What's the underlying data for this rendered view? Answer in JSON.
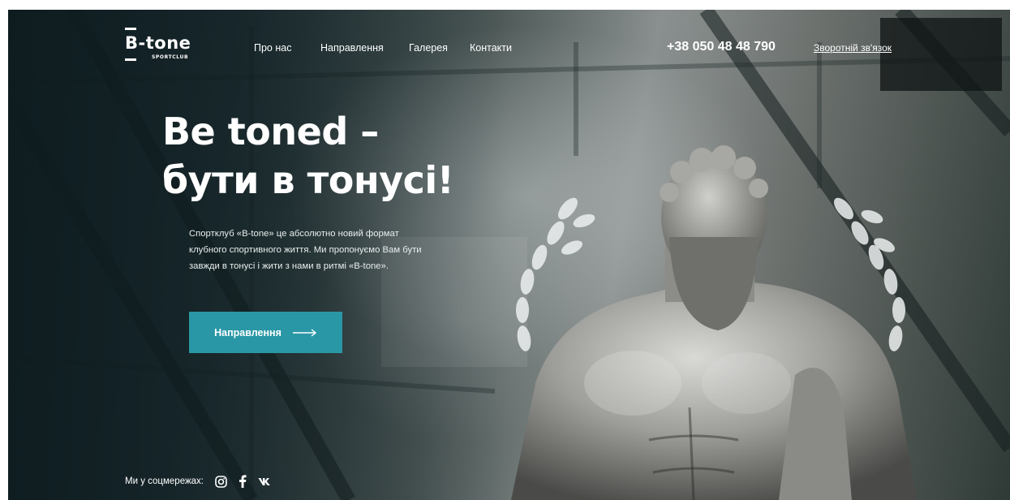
{
  "brand": {
    "name": "B-tone",
    "tagline": "SPORTCLUB"
  },
  "nav": {
    "items": [
      {
        "label": "Про нас"
      },
      {
        "label": "Направлення"
      },
      {
        "label": "Галерея"
      },
      {
        "label": "Контакти"
      }
    ]
  },
  "contact": {
    "phone": "+38 050 48 48 790",
    "callback_label": "Зворотній зв'язок"
  },
  "hero": {
    "headline_line1": "Be toned –",
    "headline_line2": "бути в тонусі!",
    "description": "Спортклуб «B-tone» це абсолютно новий формат клубного спортивного життя. Ми пропонуємо Вам бути завжди в тонусі і жити з нами в ритмі «B-tone».",
    "cta_label": "Направлення"
  },
  "social": {
    "label": "Ми у соцмережах:",
    "icons": [
      "instagram-icon",
      "facebook-icon",
      "vk-icon"
    ]
  },
  "colors": {
    "accent": "#2a97a6",
    "text": "#ffffff",
    "background_dark": "#1c2a2e"
  }
}
